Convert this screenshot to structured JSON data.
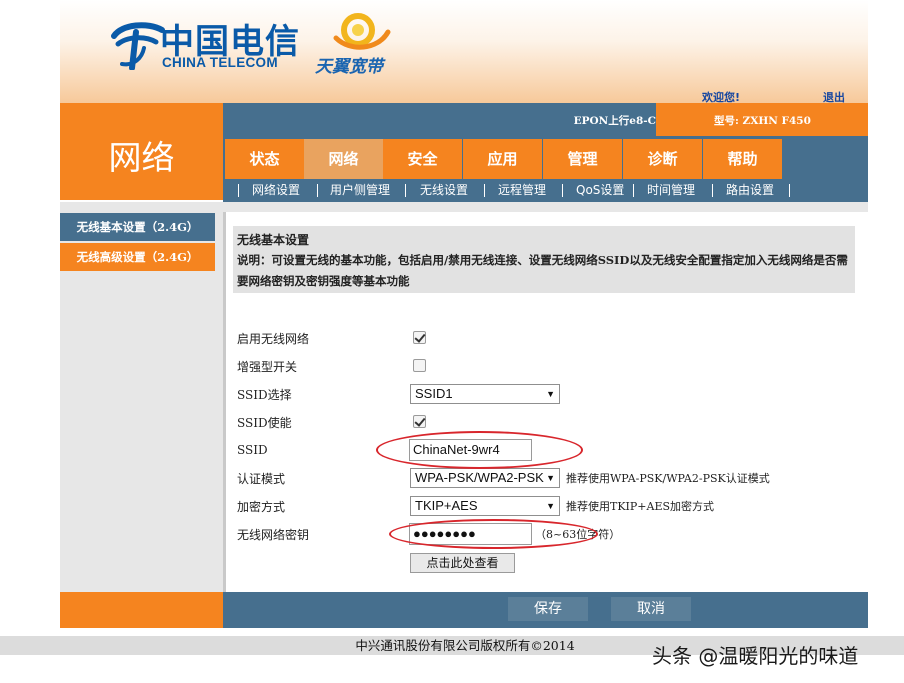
{
  "header": {
    "brand_cn": "中国电信",
    "brand_en": "CHINA TELECOM",
    "product": "天翼宽带",
    "welcome": "欢迎您!",
    "logout": "退出",
    "status": "EPON上行e8-C",
    "model": "型号: ZXHN F450"
  },
  "section_title": "网络",
  "tabs": [
    {
      "label": "状态"
    },
    {
      "label": "网络"
    },
    {
      "label": "安全"
    },
    {
      "label": "应用"
    },
    {
      "label": "管理"
    },
    {
      "label": "诊断"
    },
    {
      "label": "帮助"
    }
  ],
  "active_tab": "网络",
  "subnav": [
    {
      "label": "网络设置"
    },
    {
      "label": "用户侧管理"
    },
    {
      "label": "无线设置"
    },
    {
      "label": "远程管理"
    },
    {
      "label": "QoS设置"
    },
    {
      "label": "时间管理"
    },
    {
      "label": "路由设置"
    }
  ],
  "sidebar": {
    "items": [
      {
        "label": "无线基本设置（2.4G）"
      },
      {
        "label": "无线高级设置（2.4G）"
      }
    ]
  },
  "description": {
    "title": "无线基本设置",
    "text": "说明：可设置无线的基本功能，包括启用/禁用无线连接、设置无线网络SSID以及无线安全配置指定加入无线网络是否需要网络密钥及密钥强度等基本功能"
  },
  "form": {
    "enable_wireless": {
      "label": "启用无线网络",
      "checked": true
    },
    "enhanced_switch": {
      "label": "增强型开关",
      "checked": false
    },
    "ssid_select": {
      "label": "SSID选择",
      "value": "SSID1"
    },
    "ssid_enable": {
      "label": "SSID使能",
      "checked": true
    },
    "ssid": {
      "label": "SSID",
      "value": "ChinaNet-9wr4"
    },
    "auth_mode": {
      "label": "认证模式",
      "value": "WPA-PSK/WPA2-PSK",
      "hint": "推荐使用WPA-PSK/WPA2-PSK认证模式"
    },
    "encryption": {
      "label": "加密方式",
      "value": "TKIP+AES",
      "hint": "推荐使用TKIP+AES加密方式"
    },
    "key": {
      "label": "无线网络密钥",
      "value": "●●●●●●●●",
      "hint": "（8~63位字符）"
    },
    "view_button": "点击此处查看"
  },
  "actions": {
    "save": "保存",
    "cancel": "取消"
  },
  "footer": {
    "copyright": "中兴通讯股份有限公司版权所有©2014",
    "watermark": "头条 @温暖阳光的味道"
  },
  "colors": {
    "orange": "#f5841f",
    "slate_blue": "#466f8e",
    "telecom_blue": "#0a5aa8",
    "annotation_red": "#d8262c"
  }
}
